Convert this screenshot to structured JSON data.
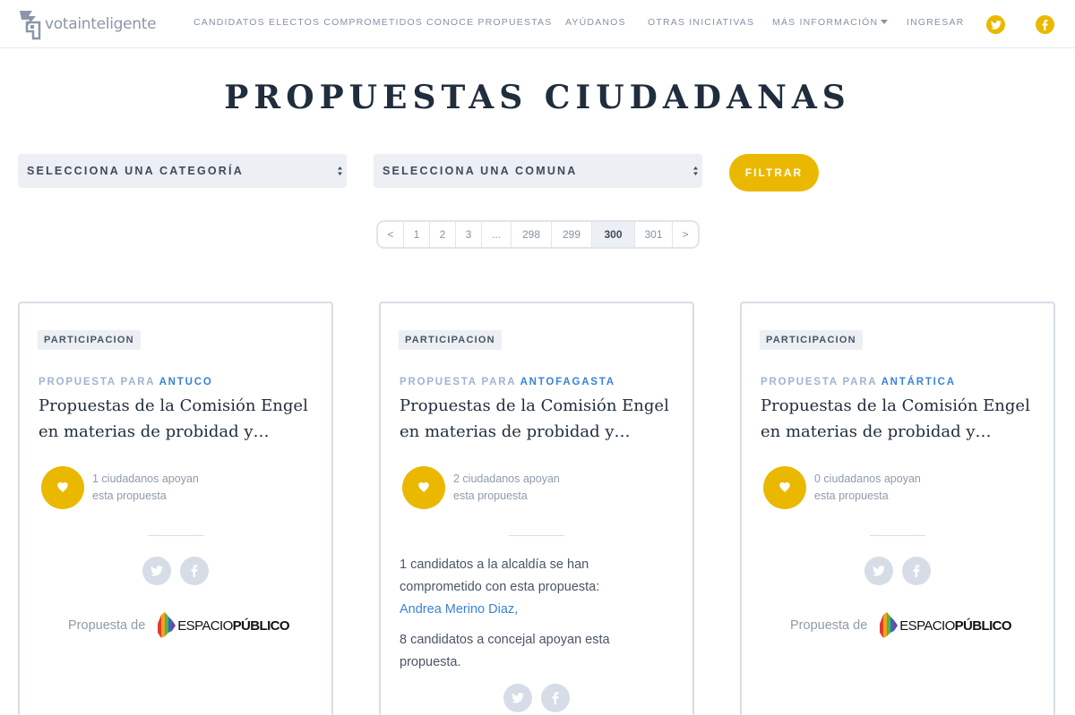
{
  "nav": {
    "brand": "votainteligente",
    "links": [
      "CANDIDATOS ELECTOS COMPROMETIDOS",
      "CONOCE PROPUESTAS",
      "AYÚDANOS",
      "OTRAS INICIATIVAS",
      "MÁS INFORMACIÓN",
      "INGRESAR"
    ],
    "social_icons": [
      "twitter-icon",
      "facebook-icon"
    ]
  },
  "page": {
    "title": "PROPUESTAS CIUDADANAS"
  },
  "filters": {
    "category_select": "SELECCIONA UNA CATEGORÍA",
    "commune_select": "SELECCIONA UNA COMUNA",
    "filter_button": "FILTRAR"
  },
  "pagination": {
    "items": [
      "<",
      "1",
      "2",
      "3",
      "...",
      "298",
      "299",
      "300",
      "301",
      ">"
    ],
    "current": "300"
  },
  "cards": [
    {
      "tag": "PARTICIPACION",
      "for_label": "PROPUESTA PARA",
      "commune": "ANTUCO",
      "title_line1": "Propuestas de la Comisión Engel",
      "title_line2": "en materias de probidad y…",
      "support_line1": "1 ciudadanos apoyan",
      "support_line2": "esta propuesta",
      "author_label": "Propuesta de",
      "author_logo_text_1": "ESPACIO",
      "author_logo_text_2": "PÚBLICO"
    },
    {
      "tag": "PARTICIPACION",
      "for_label": "PROPUESTA PARA",
      "commune": "ANTOFAGASTA",
      "title_line1": "Propuestas de la Comisión Engel",
      "title_line2": "en materias de probidad y…",
      "support_line1": "2 ciudadanos apoyan",
      "support_line2": "esta propuesta",
      "commit_line1": "1 candidatos a la alcaldía se han",
      "commit_line2": "comprometido con esta propuesta:",
      "commit_link": "Andrea Merino Diaz,",
      "council_line1": "8 candidatos a concejal apoyan esta",
      "council_line2": "propuesta."
    },
    {
      "tag": "PARTICIPACION",
      "for_label": "PROPUESTA PARA",
      "commune": "ANTÁRTICA",
      "title_line1": "Propuestas de la Comisión Engel",
      "title_line2": "en materias de probidad y…",
      "support_line1": "0 ciudadanos apoyan",
      "support_line2": "esta propuesta",
      "author_label": "Propuesta de",
      "author_logo_text_1": "ESPACIO",
      "author_logo_text_2": "PÚBLICO"
    }
  ],
  "colors": {
    "accent": "#ebb800",
    "title": "#1f2d3d",
    "link": "#3b82d6",
    "muted": "#8593a6",
    "select_bg": "#eceff3",
    "card_border": "#d7dee8"
  }
}
